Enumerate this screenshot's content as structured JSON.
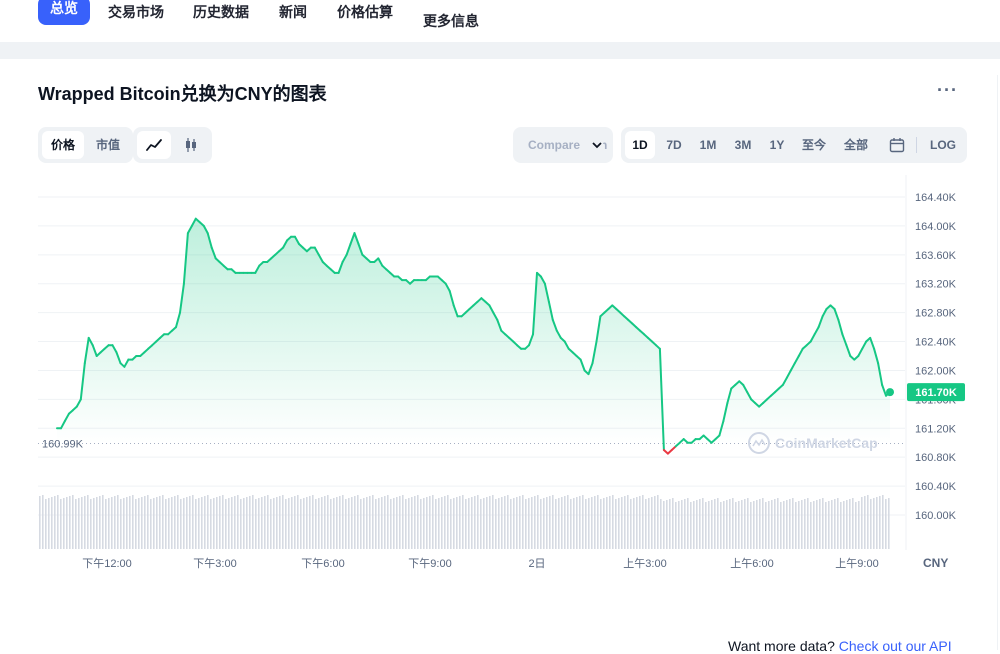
{
  "nav": {
    "items": [
      "总览",
      "交易市场",
      "历史数据",
      "新闻",
      "价格估算",
      "更多信息"
    ]
  },
  "header": {
    "title": "Wrapped Bitcoin兑换为CNY的图表",
    "more": "···"
  },
  "controls": {
    "type_toggle": [
      "价格",
      "市值"
    ],
    "compare_label": "Compare with",
    "ranges": [
      "1D",
      "7D",
      "1M",
      "3M",
      "1Y",
      "至今",
      "全部"
    ],
    "log_label": "LOG"
  },
  "colors": {
    "accent": "#3861fb",
    "up": "#16c784",
    "down": "#ea3943"
  },
  "icons": {
    "line_chart": "line-chart-icon",
    "candlestick": "candlestick-icon",
    "calendar": "calendar-icon",
    "chevron": "chevron-down-icon"
  },
  "chart_data": {
    "type": "line",
    "currency": "CNY",
    "x_ticks": [
      "下午12:00",
      "下午3:00",
      "下午6:00",
      "下午9:00",
      "2日",
      "上午3:00",
      "上午6:00",
      "上午9:00"
    ],
    "y_ticks": [
      "160.00K",
      "160.40K",
      "160.80K",
      "161.20K",
      "161.60K",
      "162.00K",
      "162.40K",
      "162.80K",
      "163.20K",
      "163.60K",
      "164.00K",
      "164.40K"
    ],
    "ylim": [
      159.9,
      164.6
    ],
    "reference_value": 160.99,
    "reference_label": "160.99K",
    "current_value": 161.7,
    "current_label": "161.70K",
    "watermark": "CoinMarketCap",
    "series": [
      {
        "values": [
          161.2,
          161.2,
          161.3,
          161.4,
          161.45,
          161.5,
          161.6,
          162.1,
          162.45,
          162.35,
          162.2,
          162.25,
          162.3,
          162.35,
          162.35,
          162.25,
          162.1,
          162.05,
          162.15,
          162.15,
          162.2,
          162.2,
          162.25,
          162.3,
          162.35,
          162.4,
          162.45,
          162.5,
          162.5,
          162.55,
          162.6,
          162.8,
          163.2,
          163.9,
          164.0,
          164.1,
          164.05,
          164.0,
          163.9,
          163.7,
          163.55,
          163.5,
          163.45,
          163.4,
          163.4,
          163.35,
          163.35,
          163.35,
          163.35,
          163.35,
          163.35,
          163.45,
          163.5,
          163.5,
          163.55,
          163.6,
          163.65,
          163.7,
          163.8,
          163.85,
          163.85,
          163.75,
          163.7,
          163.65,
          163.7,
          163.7,
          163.6,
          163.5,
          163.45,
          163.4,
          163.35,
          163.35,
          163.5,
          163.6,
          163.75,
          163.9,
          163.75,
          163.6,
          163.55,
          163.5,
          163.5,
          163.55,
          163.45,
          163.4,
          163.35,
          163.3,
          163.3,
          163.25,
          163.25,
          163.2,
          163.25,
          163.25,
          163.25,
          163.25,
          163.3,
          163.3,
          163.3,
          163.25,
          163.2,
          163.1,
          162.9,
          162.75,
          162.75,
          162.8,
          162.85,
          162.9,
          162.95,
          163.0,
          162.95,
          162.9,
          162.8,
          162.7,
          162.55,
          162.5,
          162.45,
          162.4,
          162.35,
          162.3,
          162.3,
          162.35,
          162.5,
          163.35,
          163.3,
          163.2,
          162.95,
          162.7,
          162.55,
          162.45,
          162.4,
          162.3,
          162.25,
          162.2,
          162.15,
          162.0,
          161.95,
          162.1,
          162.4,
          162.75,
          162.8,
          162.85,
          162.9,
          162.85,
          162.8,
          162.75,
          162.7,
          162.65,
          162.6,
          162.55,
          162.5,
          162.45,
          162.4,
          162.35,
          162.3,
          160.9,
          160.85,
          160.9,
          160.95,
          161.0,
          161.05,
          161.0,
          161.0,
          161.05,
          161.05,
          161.1,
          161.05,
          161.0,
          161.05,
          161.1,
          161.3,
          161.55,
          161.75,
          161.8,
          161.85,
          161.8,
          161.7,
          161.6,
          161.55,
          161.5,
          161.55,
          161.6,
          161.65,
          161.7,
          161.75,
          161.8,
          161.9,
          162.0,
          162.1,
          162.2,
          162.3,
          162.35,
          162.4,
          162.5,
          162.6,
          162.75,
          162.85,
          162.9,
          162.85,
          162.7,
          162.5,
          162.35,
          162.2,
          162.15,
          162.2,
          162.3,
          162.4,
          162.45,
          162.3,
          162.1,
          161.8,
          161.65,
          161.7
        ]
      }
    ]
  },
  "footer": {
    "prefix": "Want more data?",
    "link": "Check out our API"
  }
}
